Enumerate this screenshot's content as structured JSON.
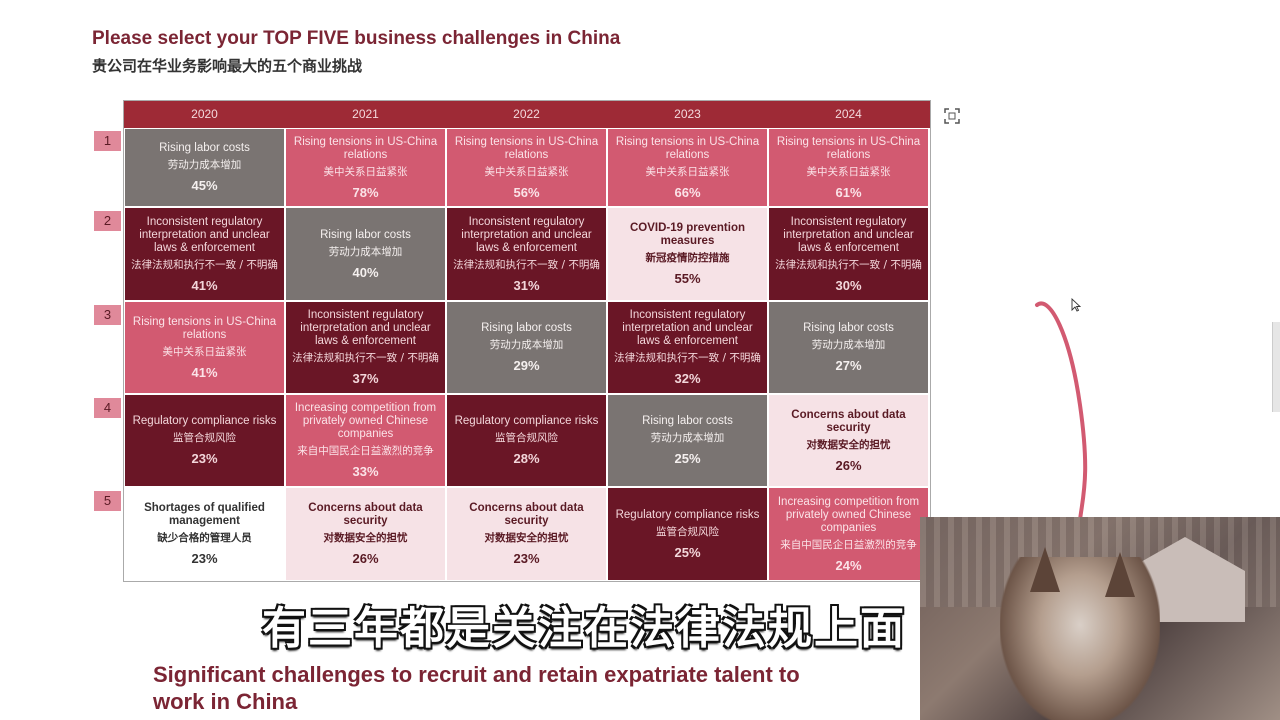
{
  "title_en": "Please select your TOP FIVE business challenges in China",
  "title_cn": "贵公司在华业务影响最大的五个商业挑战",
  "years": [
    "2020",
    "2021",
    "2022",
    "2023",
    "2024"
  ],
  "ranks": [
    "1",
    "2",
    "3",
    "4",
    "5"
  ],
  "cells": [
    [
      {
        "en": "Rising labor costs",
        "cn": "劳动力成本增加",
        "pct": "45%",
        "style": "gray"
      },
      {
        "en": "Rising tensions in US-China relations",
        "cn": "美中关系日益紧张",
        "pct": "78%",
        "style": "pink"
      },
      {
        "en": "Rising tensions in US-China relations",
        "cn": "美中关系日益紧张",
        "pct": "56%",
        "style": "pink"
      },
      {
        "en": "Rising tensions in US-China relations",
        "cn": "美中关系日益紧张",
        "pct": "66%",
        "style": "pink"
      },
      {
        "en": "Rising tensions in US-China relations",
        "cn": "美中关系日益紧张",
        "pct": "61%",
        "style": "pink"
      }
    ],
    [
      {
        "en": "Inconsistent regulatory interpretation and unclear laws & enforcement",
        "cn": "法律法规和执行不一致 / 不明确",
        "pct": "41%",
        "style": "maroon"
      },
      {
        "en": "Rising labor costs",
        "cn": "劳动力成本增加",
        "pct": "40%",
        "style": "gray"
      },
      {
        "en": "Inconsistent regulatory interpretation and unclear laws & enforcement",
        "cn": "法律法规和执行不一致 / 不明确",
        "pct": "31%",
        "style": "maroon"
      },
      {
        "en": "COVID-19 prevention measures",
        "cn": "新冠疫情防控措施",
        "pct": "55%",
        "style": "light"
      },
      {
        "en": "Inconsistent regulatory interpretation and unclear laws & enforcement",
        "cn": "法律法规和执行不一致 / 不明确",
        "pct": "30%",
        "style": "maroon"
      }
    ],
    [
      {
        "en": "Rising tensions in US-China relations",
        "cn": "美中关系日益紧张",
        "pct": "41%",
        "style": "pink"
      },
      {
        "en": "Inconsistent regulatory interpretation and unclear laws & enforcement",
        "cn": "法律法规和执行不一致 / 不明确",
        "pct": "37%",
        "style": "maroon"
      },
      {
        "en": "Rising labor costs",
        "cn": "劳动力成本增加",
        "pct": "29%",
        "style": "gray"
      },
      {
        "en": "Inconsistent regulatory interpretation and unclear laws & enforcement",
        "cn": "法律法规和执行不一致 / 不明确",
        "pct": "32%",
        "style": "maroon"
      },
      {
        "en": "Rising labor costs",
        "cn": "劳动力成本增加",
        "pct": "27%",
        "style": "gray"
      }
    ],
    [
      {
        "en": "Regulatory compliance risks",
        "cn": "监管合规风险",
        "pct": "23%",
        "style": "maroon"
      },
      {
        "en": "Increasing competition from privately owned Chinese companies",
        "cn": "来自中国民企日益激烈的竞争",
        "pct": "33%",
        "style": "pink"
      },
      {
        "en": "Regulatory compliance risks",
        "cn": "监管合规风险",
        "pct": "28%",
        "style": "maroon"
      },
      {
        "en": "Rising labor costs",
        "cn": "劳动力成本增加",
        "pct": "25%",
        "style": "gray"
      },
      {
        "en": "Concerns about data security",
        "cn": "对数据安全的担忧",
        "pct": "26%",
        "style": "light"
      }
    ],
    [
      {
        "en": "Shortages of qualified management",
        "cn": "缺少合格的管理人员",
        "pct": "23%",
        "style": "white"
      },
      {
        "en": "Concerns about data security",
        "cn": "对数据安全的担忧",
        "pct": "26%",
        "style": "light"
      },
      {
        "en": "Concerns about data security",
        "cn": "对数据安全的担忧",
        "pct": "23%",
        "style": "light"
      },
      {
        "en": "Regulatory compliance risks",
        "cn": "监管合规风险",
        "pct": "25%",
        "style": "maroon"
      },
      {
        "en": "Increasing competition from privately owned Chinese companies",
        "cn": "来自中国民企日益激烈的竞争",
        "pct": "24%",
        "style": "pink"
      }
    ]
  ],
  "bottom_title": "Significant challenges to recruit and retain expatriate talent to work in China",
  "subtitle": "有三年都是关注在法律法规上面",
  "colors": {
    "header": "#9e2a36",
    "gray": "#7a7472",
    "pink": "#d25a71",
    "maroon": "#6a1626",
    "light": "#f6e2e6",
    "title": "#7b2534"
  }
}
